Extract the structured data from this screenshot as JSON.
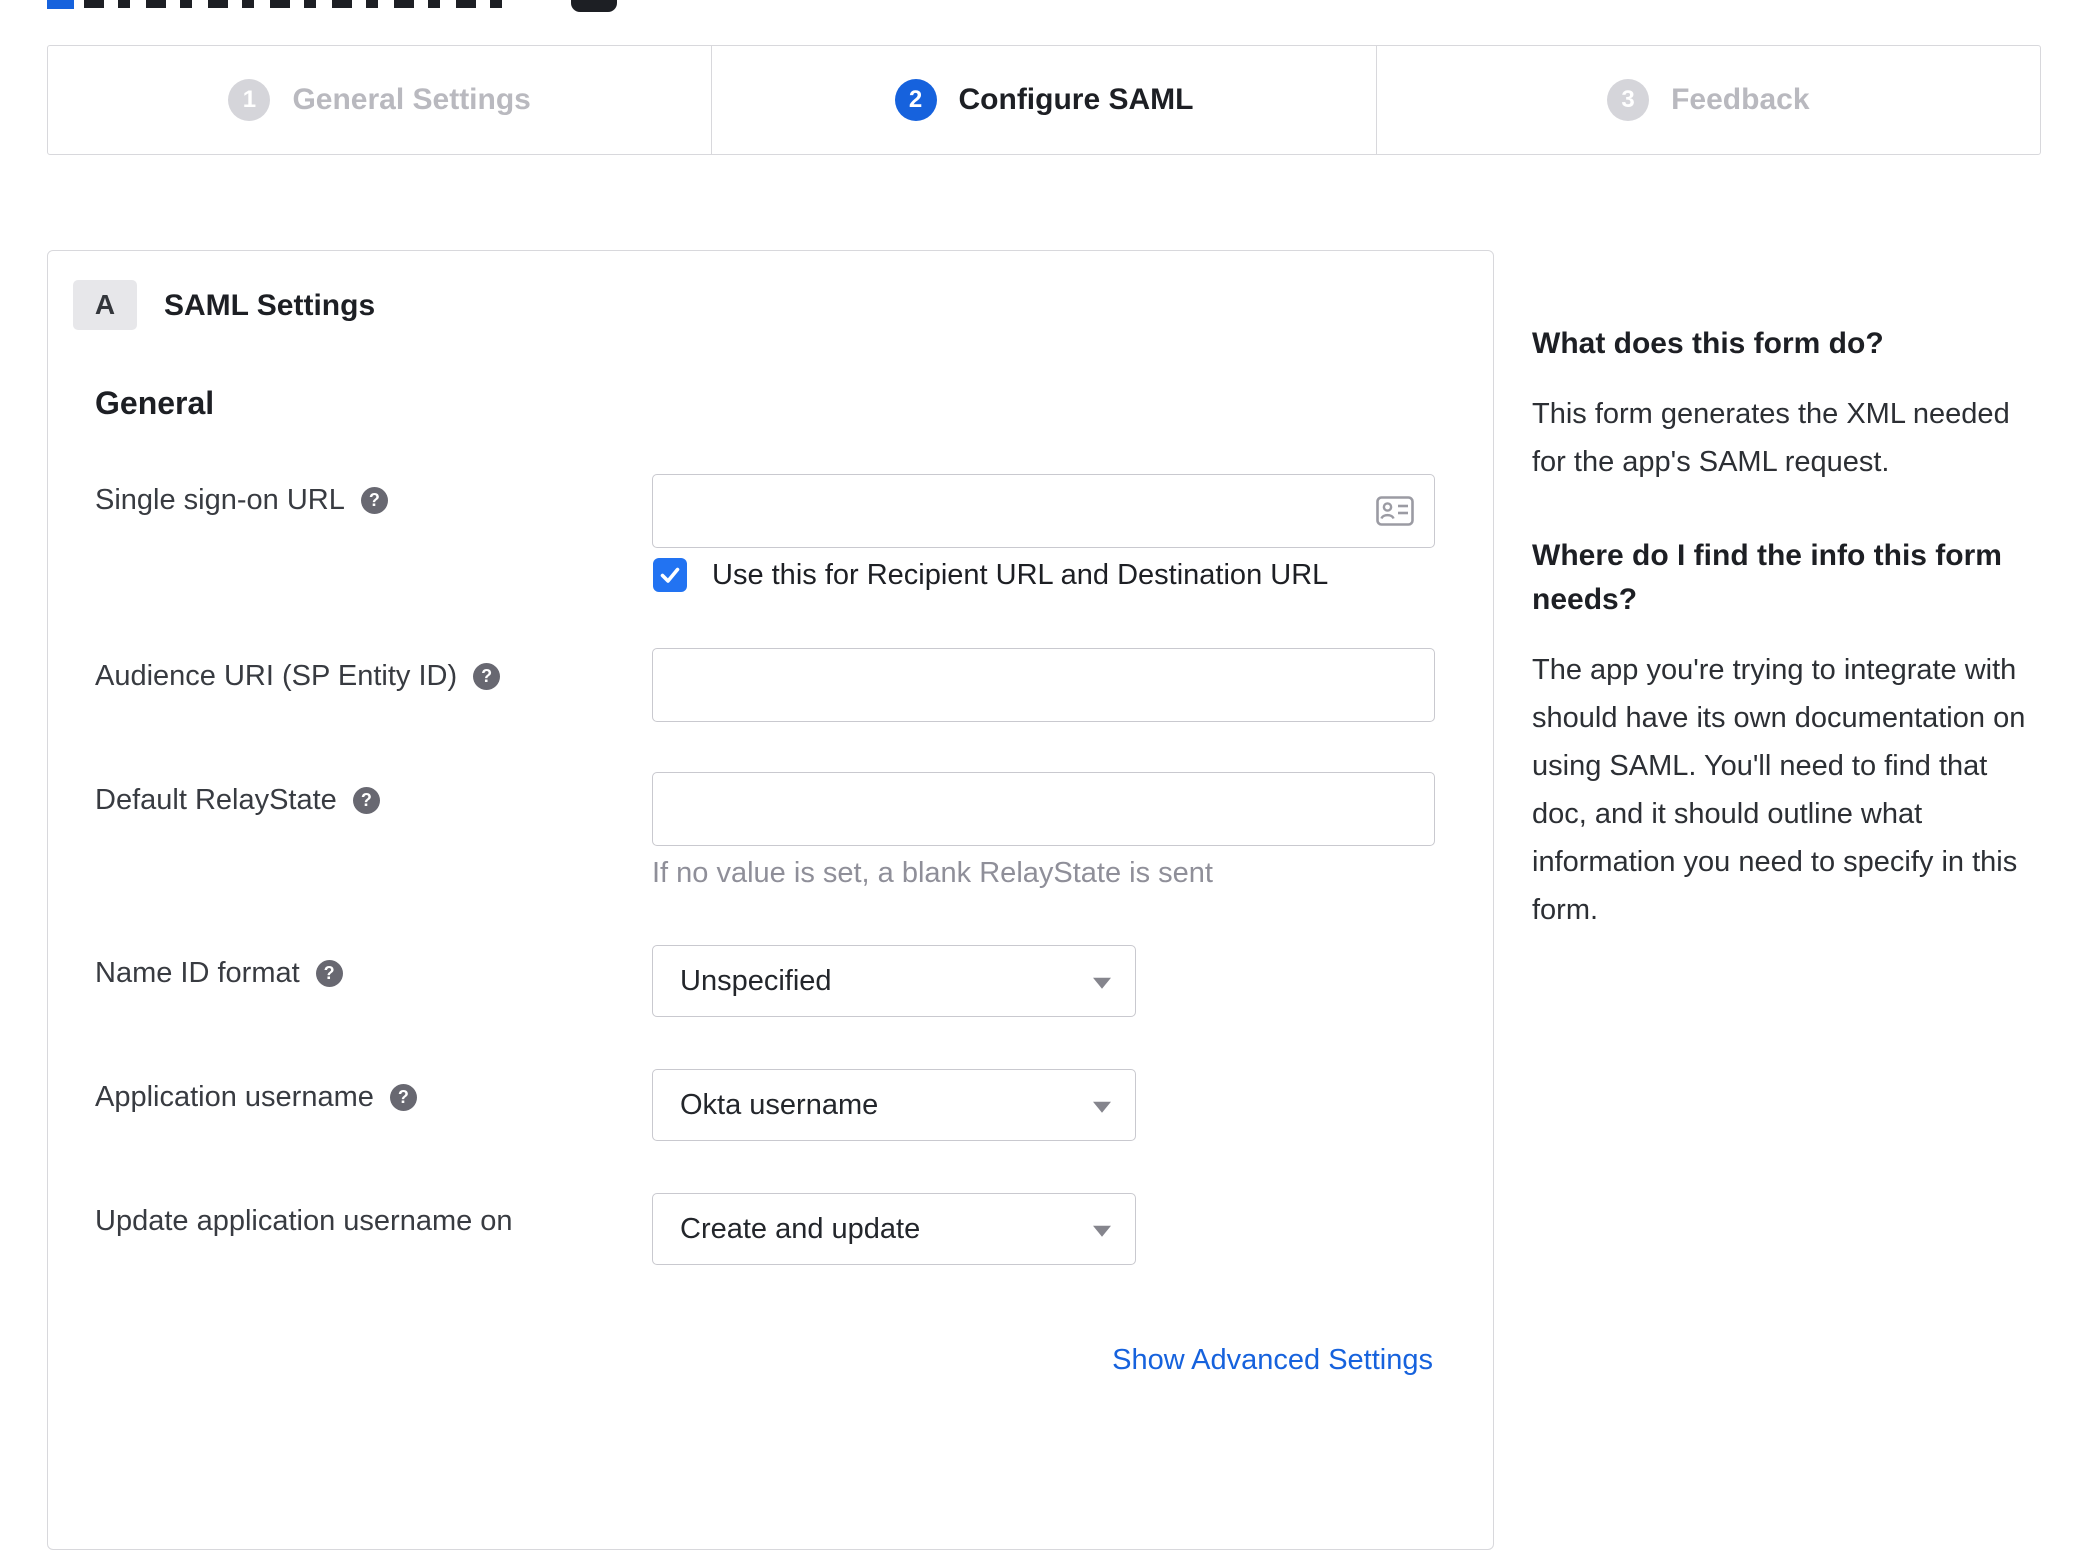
{
  "colors": {
    "accent_blue": "#1662dd",
    "checkbox_blue": "#2273f2",
    "link_blue": "#1662dd",
    "inactive_gray": "#d5d5da",
    "border_gray": "#d8d8dc"
  },
  "icons": {
    "help_glyph": "?"
  },
  "stepper": {
    "steps": [
      {
        "number": "1",
        "label": "General Settings",
        "state": "inactive"
      },
      {
        "number": "2",
        "label": "Configure SAML",
        "state": "active"
      },
      {
        "number": "3",
        "label": "Feedback",
        "state": "inactive"
      }
    ]
  },
  "panel": {
    "section_badge": "A",
    "section_title": "SAML Settings",
    "group_title": "General",
    "fields": {
      "sso": {
        "label": "Single sign-on URL",
        "value": "",
        "checkbox_label": "Use this for Recipient URL and Destination URL",
        "checkbox_checked": true
      },
      "audience": {
        "label": "Audience URI (SP Entity ID)",
        "value": ""
      },
      "relay": {
        "label": "Default RelayState",
        "value": "",
        "hint": "If no value is set, a blank RelayState is sent"
      },
      "nameid": {
        "label": "Name ID format",
        "value": "Unspecified"
      },
      "appusername": {
        "label": "Application username",
        "value": "Okta username"
      },
      "update": {
        "label": "Update application username on",
        "value": "Create and update"
      }
    },
    "advanced_link": "Show Advanced Settings"
  },
  "sidebar": {
    "sections": [
      {
        "heading": "What does this form do?",
        "body": "This form generates the XML needed for the app's SAML request."
      },
      {
        "heading": "Where do I find the info this form needs?",
        "body": "The app you're trying to integrate with should have its own documentation on using SAML. You'll need to find that doc, and it should outline what information you need to specify in this form."
      }
    ]
  }
}
